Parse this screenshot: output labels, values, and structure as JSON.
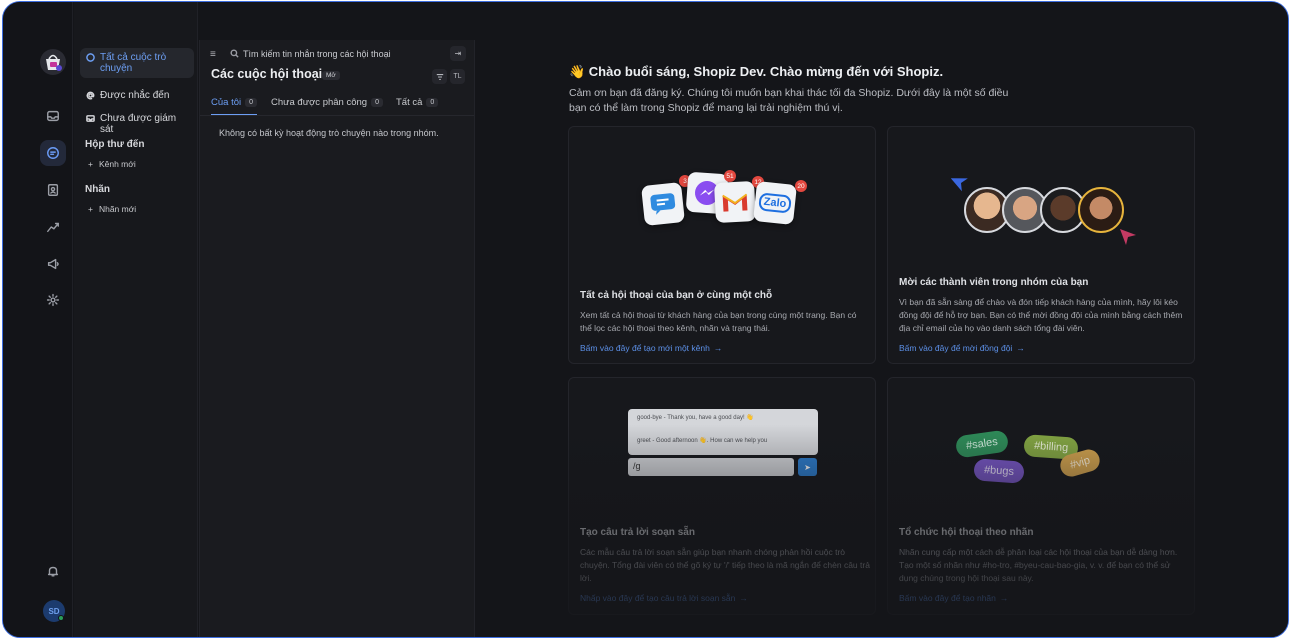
{
  "rail": {
    "icons": [
      "inbox-icon",
      "conversations-icon",
      "contacts-icon",
      "reports-icon",
      "campaigns-icon",
      "settings-icon"
    ],
    "avatar_initials": "SD"
  },
  "sidebar": {
    "all_conversations": "Tất cả cuộc trò chuyện",
    "mentions": "Được nhắc đến",
    "unattended": "Chưa được giám sát",
    "inbox_heading": "Hộp thư đến",
    "new_inbox": "Kênh mới",
    "labels_heading": "Nhãn",
    "new_label": "Nhãn mới"
  },
  "conversations": {
    "search_placeholder": "Tìm kiếm tin nhắn trong các hội thoại",
    "title": "Các cuộc hội thoại",
    "status": "Mở",
    "sort_label": "TL",
    "tabs": [
      {
        "label": "Của tôi",
        "count": "0"
      },
      {
        "label": "Chưa được phân công",
        "count": "0"
      },
      {
        "label": "Tất cả",
        "count": "0"
      }
    ],
    "empty_message": "Không có bất kỳ hoạt động trò chuyện nào trong nhóm."
  },
  "main": {
    "greeting": "👋 Chào buổi sáng, Shopiz Dev. Chào mừng đến với Shopiz.",
    "intro": "Cảm ơn bạn đã đăng ký. Chúng tôi muốn bạn khai thác tối đa Shopiz. Dưới đây là một số điều bạn có thể làm trong Shopiz để mang lại trải nghiệm thú vị.",
    "cards": [
      {
        "title": "Tất cả hội thoại của bạn ở cùng một chỗ",
        "desc": "Xem tất cả hội thoại từ khách hàng của bạn trong cùng một trang. Bạn có thể lọc các hội thoại theo kênh, nhãn và trạng thái.",
        "link": "Bấm vào đây để tạo mới một kênh",
        "badges": [
          "3",
          "51",
          "12",
          "20"
        ],
        "zalo_label": "Zalo"
      },
      {
        "title": "Mời các thành viên trong nhóm của bạn",
        "desc": "Vì bạn đã sẵn sàng để chào và đón tiếp khách hàng của mình, hãy lôi kéo đồng đội để hỗ trợ bạn. Bạn có thể mời đồng đội của mình bằng cách thêm địa chỉ email của họ vào danh sách tổng đài viên.",
        "link": "Bấm vào đây để mời đồng đội"
      },
      {
        "title": "Tạo câu trả lời soạn sẵn",
        "desc": "Các mẫu câu trả lời soạn sẵn giúp bạn nhanh chóng phản hồi cuộc trò chuyện. Tổng đài viên có thể gõ ký tự '/' tiếp theo là mã ngắn để chèn câu trả lời.",
        "link": "Nhấp vào đây để tạo câu trả lời soạn sẵn",
        "msg1": "good-bye - Thank you, have a good day! 👋",
        "msg2": "greet - Good afternoon 👋. How can we help you",
        "input_value": "/g"
      },
      {
        "title": "Tổ chức hội thoại theo nhãn",
        "desc": "Nhãn cung cấp một cách dễ phân loại các hội thoại của bạn dễ dàng hơn. Tạo một số nhãn như #ho-tro, #byeu-cau-bao-gia, v. v. để bạn có thể sử dụng chúng trong hội thoại sau này.",
        "link": "Bấm vào đây để tạo nhãn",
        "labels": [
          "#sales",
          "#billing",
          "#bugs",
          "#vip"
        ]
      }
    ]
  },
  "colors": {
    "accent": "#6c9ef4",
    "background": "#141519",
    "link": "#5c8fe6"
  }
}
